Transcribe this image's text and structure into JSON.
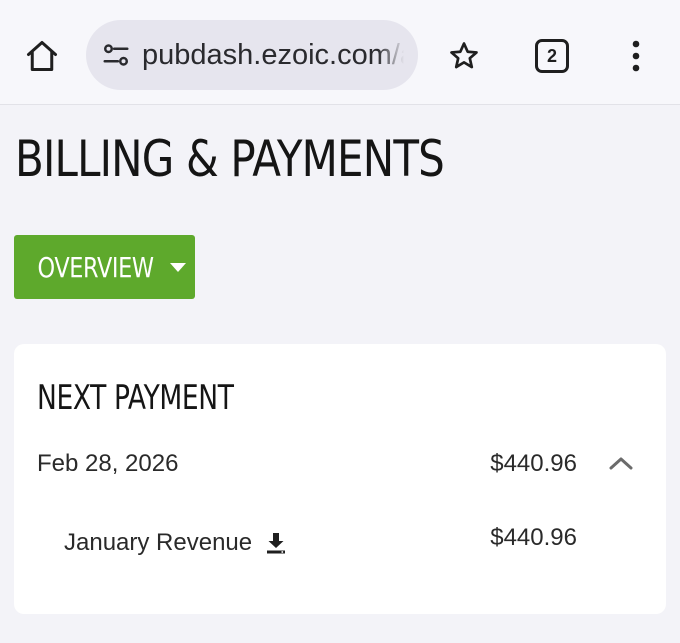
{
  "browser": {
    "url": "pubdash.ezoic.com/a",
    "tab_count": "2",
    "icons": [
      "home-icon",
      "site-settings-icon",
      "star-icon",
      "tab-switcher-icon",
      "more-vert-icon"
    ]
  },
  "page": {
    "title": "BILLING & PAYMENTS",
    "overview_button": "OVERVIEW",
    "accent_color": "#5ea92c"
  },
  "next_payment": {
    "heading": "NEXT PAYMENT",
    "date": "Feb 28, 2026",
    "amount": "$440.96",
    "items": [
      {
        "label": "January Revenue",
        "amount": "$440.96"
      }
    ]
  }
}
